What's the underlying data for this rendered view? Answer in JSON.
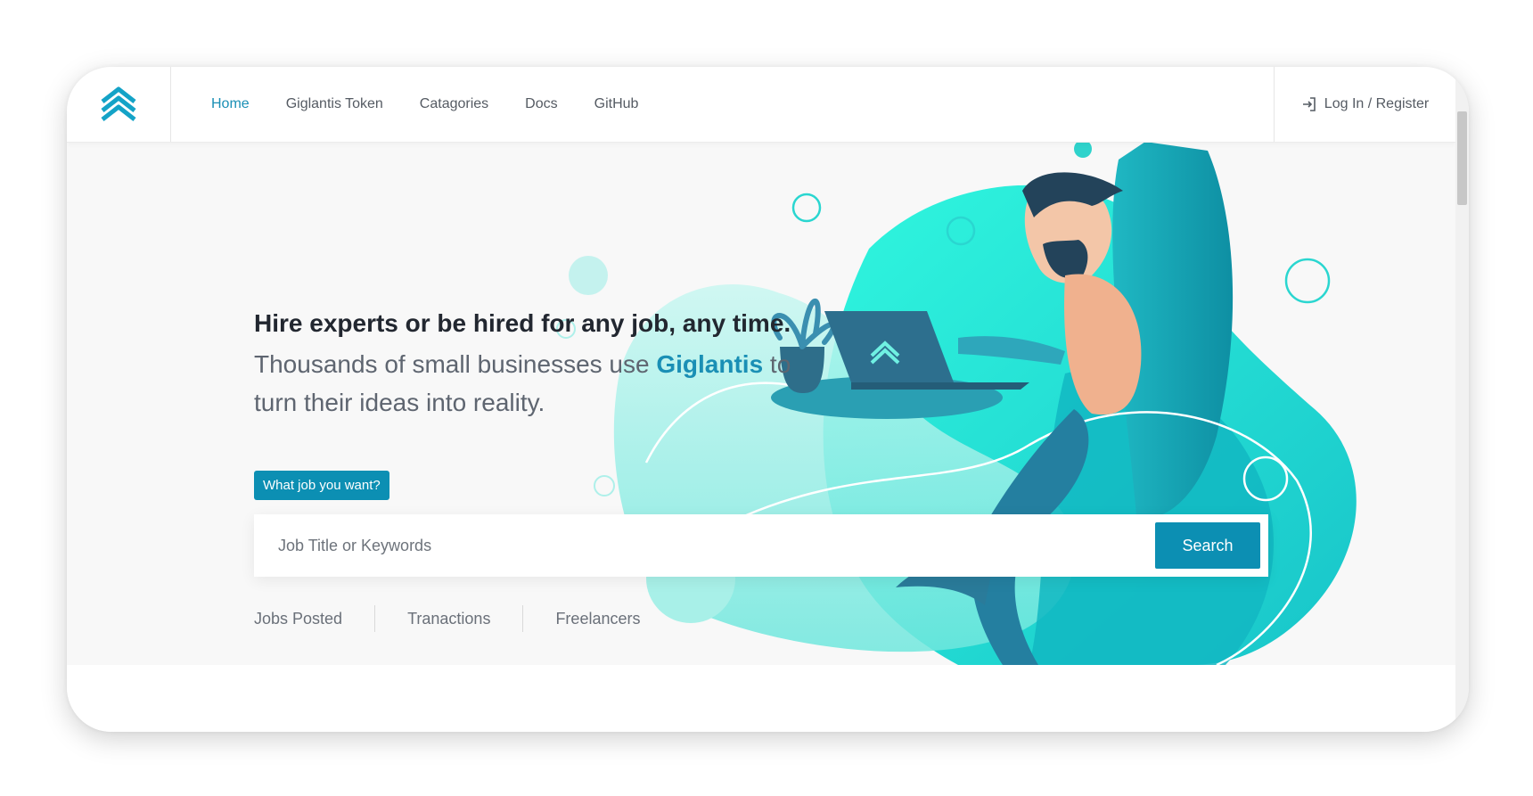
{
  "nav": {
    "links": [
      {
        "label": "Home"
      },
      {
        "label": "Giglantis Token"
      },
      {
        "label": "Catagories"
      },
      {
        "label": "Docs"
      },
      {
        "label": "GitHub"
      }
    ],
    "login_label": "Log In / Register"
  },
  "hero": {
    "headline": "Hire experts or be hired for any job, any time.",
    "sub_before": "Thousands of small businesses use ",
    "sub_brand": "Giglantis",
    "sub_after": " to turn their ideas into reality.",
    "tag": "What job you want?",
    "search_placeholder": "Job Title or Keywords",
    "search_button": "Search",
    "stats": [
      {
        "label": "Jobs Posted"
      },
      {
        "label": "Tranactions"
      },
      {
        "label": "Freelancers"
      }
    ]
  },
  "colors": {
    "accent": "#0c8fb3",
    "aqua": "#2af3dc",
    "teal": "#12b7c2"
  }
}
